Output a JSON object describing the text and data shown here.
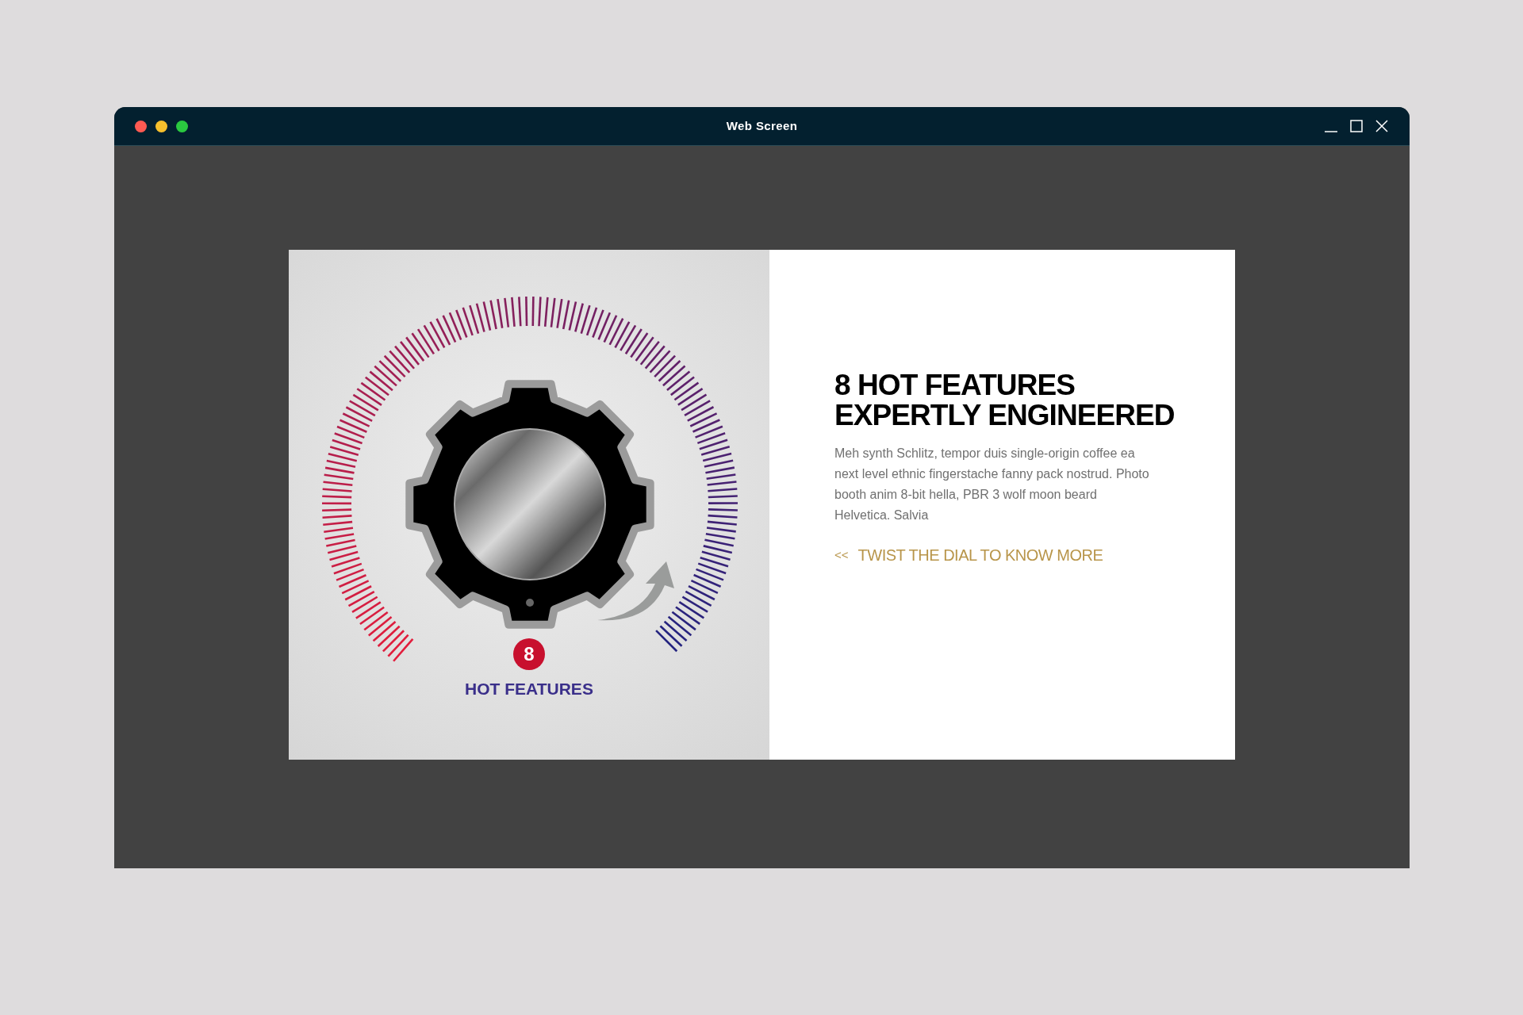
{
  "window": {
    "title": "Web Screen"
  },
  "dial": {
    "badge": "8",
    "label": "HOT FEATURES"
  },
  "content": {
    "heading": [
      "8 HOT FEATURES",
      "EXPERTLY ENGINEERED"
    ],
    "paragraph": "Meh synth Schlitz, tempor duis single-origin coffee ea next level ethnic fingerstache fanny pack nostrud. Photo booth anim 8-bit hella, PBR 3 wolf moon beard Helvetica. Salvia",
    "link": {
      "arrow": "<<",
      "label": "TWIST THE DIAL TO KNOW MORE"
    }
  }
}
